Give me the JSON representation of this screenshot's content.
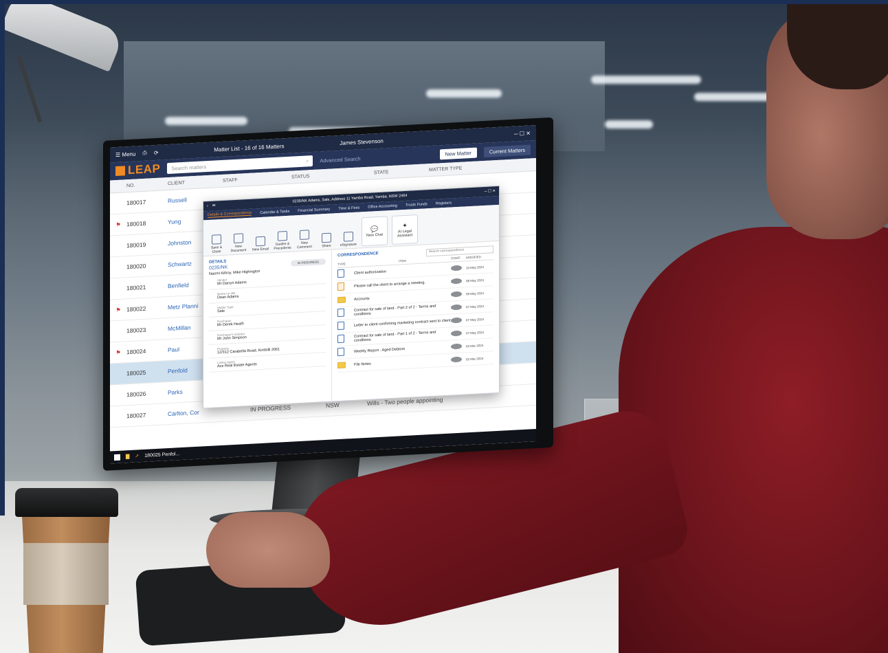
{
  "app": {
    "window_title": "Matter List - 16 of 16 Matters",
    "user_name": "James Stevenson",
    "menu_label": "Menu",
    "logo_text": "LEAP"
  },
  "toolbar": {
    "search_placeholder": "Search matters",
    "advanced_search": "Advanced Search",
    "new_matter": "New Matter",
    "current_matters": "Current Matters"
  },
  "matter_list": {
    "columns": [
      "NO.",
      "CLIENT",
      "STAFF",
      "STATUS",
      "STATE",
      "MATTER TYPE"
    ],
    "rows": [
      {
        "no": "180017",
        "client": "Russell"
      },
      {
        "no": "180018",
        "client": "Yung"
      },
      {
        "no": "180019",
        "client": "Johnston"
      },
      {
        "no": "180020",
        "client": "Schwartz"
      },
      {
        "no": "180021",
        "client": "Benfield"
      },
      {
        "no": "180022",
        "client": "Metz Planni"
      },
      {
        "no": "180023",
        "client": "McMillan"
      },
      {
        "no": "180024",
        "client": "Paul"
      },
      {
        "no": "180025",
        "client": "Penfold"
      },
      {
        "no": "180026",
        "client": "Parks"
      },
      {
        "no": "180027",
        "client": "Carlton, Cor"
      }
    ],
    "row_extra": {
      "status": "IN PROGRESS",
      "state": "NSW",
      "matter_type": "Wills - Two people appointing"
    }
  },
  "matter_window": {
    "title": "0235/NK Adams, Sale, Address 11 Yamba Road, Yamba, NSW 2464",
    "tabs": [
      "Details & Correspondence",
      "Calendar & Tasks",
      "Financial Summary",
      "Time & Fees",
      "Office Accounting",
      "Trusts Funds",
      "Registers"
    ],
    "ribbon": [
      "Save & Close",
      "New Document",
      "New Email",
      "Guides & Precedents",
      "New Comment",
      "Share",
      "eSignature"
    ],
    "ai_new_chat": "New Chat",
    "ai_legal_assistant": "AI Legal Assistant",
    "details": {
      "heading": "DETAILS",
      "code": "0235/NK",
      "status": "IN PROGRESS",
      "clients": "Naomi Killroy, Mike Highington",
      "fields": [
        {
          "label": "Vendor",
          "value": "Mr Darryn Adams"
        },
        {
          "label": "Name on title",
          "value": "Dean Adams"
        },
        {
          "label": "Matter Type",
          "value": "Sale"
        },
        {
          "label": "Purchaser",
          "value": "Mr Derek Heath"
        },
        {
          "label": "Purchaser's solicitor",
          "value": "Mr John Simpson"
        },
        {
          "label": "Property",
          "value": "12/312 Carabella Road, Kirribilli 2061"
        },
        {
          "label": "Listing Agent",
          "value": "Ace Real Estate Agents"
        }
      ]
    },
    "correspondence": {
      "heading": "CORRESPONDENCE",
      "search_placeholder": "Search correspondence",
      "columns": [
        "TYPE",
        "ITEM",
        "STAFF",
        "MODIFIED"
      ],
      "items": [
        {
          "type": "doc",
          "name": "Client authorization",
          "date": "10 May 2024"
        },
        {
          "type": "note",
          "name": "Please call the client to arrange a meeting.",
          "date": "08 May 2024"
        },
        {
          "type": "folder",
          "name": "Accounts",
          "date": "09 May 2024"
        },
        {
          "type": "doc",
          "name": "Contract for sale of land - Part 2 of 2 - Terms and conditions",
          "date": "07 May 2024"
        },
        {
          "type": "doc",
          "name": "Letter to client confirming marketing contract sent to client",
          "date": "07 May 2024"
        },
        {
          "type": "doc",
          "name": "Contract for sale of land - Part 1 of 2 - Terms and conditions",
          "date": "07 May 2024"
        },
        {
          "type": "doc",
          "name": "Weekly Report - Aged Debtors",
          "date": "03 Mar 2024"
        },
        {
          "type": "folder",
          "name": "File Notes",
          "date": "02 Mar 2024"
        }
      ]
    }
  },
  "taskbar": {
    "active_item": "180025 Penfol..."
  }
}
